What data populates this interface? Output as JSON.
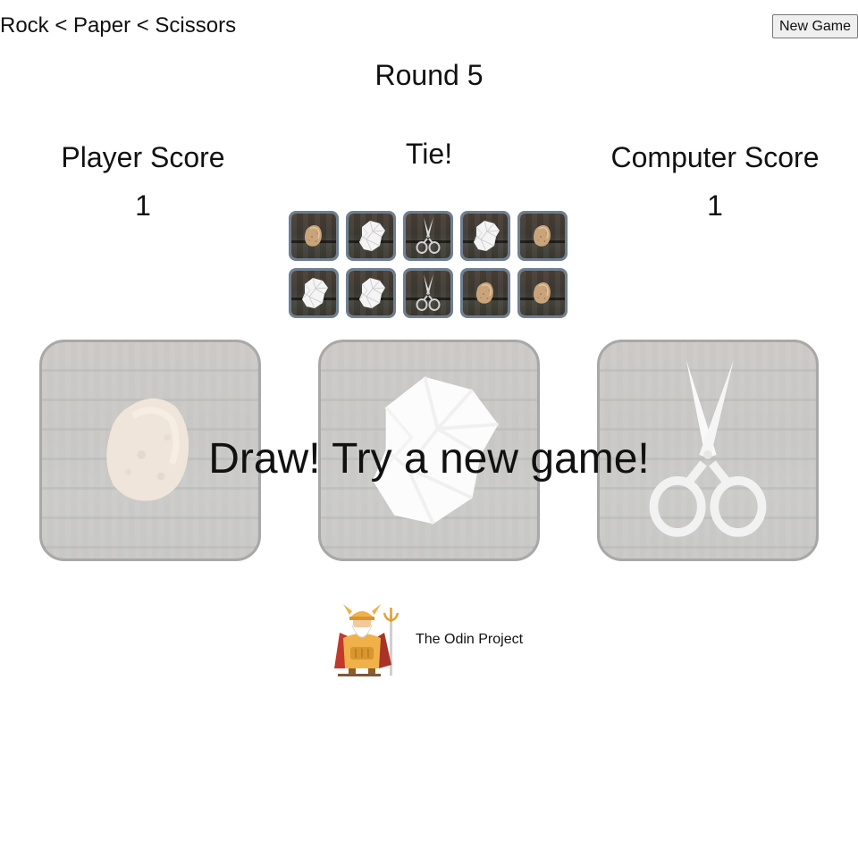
{
  "header": {
    "title": "Rock < Paper < Scissors",
    "new_game_label": "New Game"
  },
  "round": {
    "label": "Round 5"
  },
  "scores": {
    "player_title": "Player Score",
    "player_value": "1",
    "computer_title": "Computer Score",
    "computer_value": "1"
  },
  "result": {
    "label": "Tie!"
  },
  "history": {
    "items": [
      {
        "icon": "rock-icon"
      },
      {
        "icon": "paper-icon"
      },
      {
        "icon": "scissors-icon"
      },
      {
        "icon": "paper-icon"
      },
      {
        "icon": "rock-icon"
      },
      {
        "icon": "paper-icon"
      },
      {
        "icon": "paper-icon"
      },
      {
        "icon": "scissors-icon"
      },
      {
        "icon": "rock-icon"
      },
      {
        "icon": "rock-icon"
      }
    ]
  },
  "choices": [
    {
      "name": "rock",
      "icon": "rock-icon"
    },
    {
      "name": "paper",
      "icon": "paper-icon"
    },
    {
      "name": "scissors",
      "icon": "scissors-icon"
    }
  ],
  "overlay": {
    "message": "Draw! Try a new game!"
  },
  "footer": {
    "link_text": "The Odin Project",
    "logo_icon": "odin-logo-icon"
  },
  "colors": {
    "thumb_border": "#6f7f90",
    "choice_border": "#a8a8a8",
    "button_background": "#efefef"
  }
}
